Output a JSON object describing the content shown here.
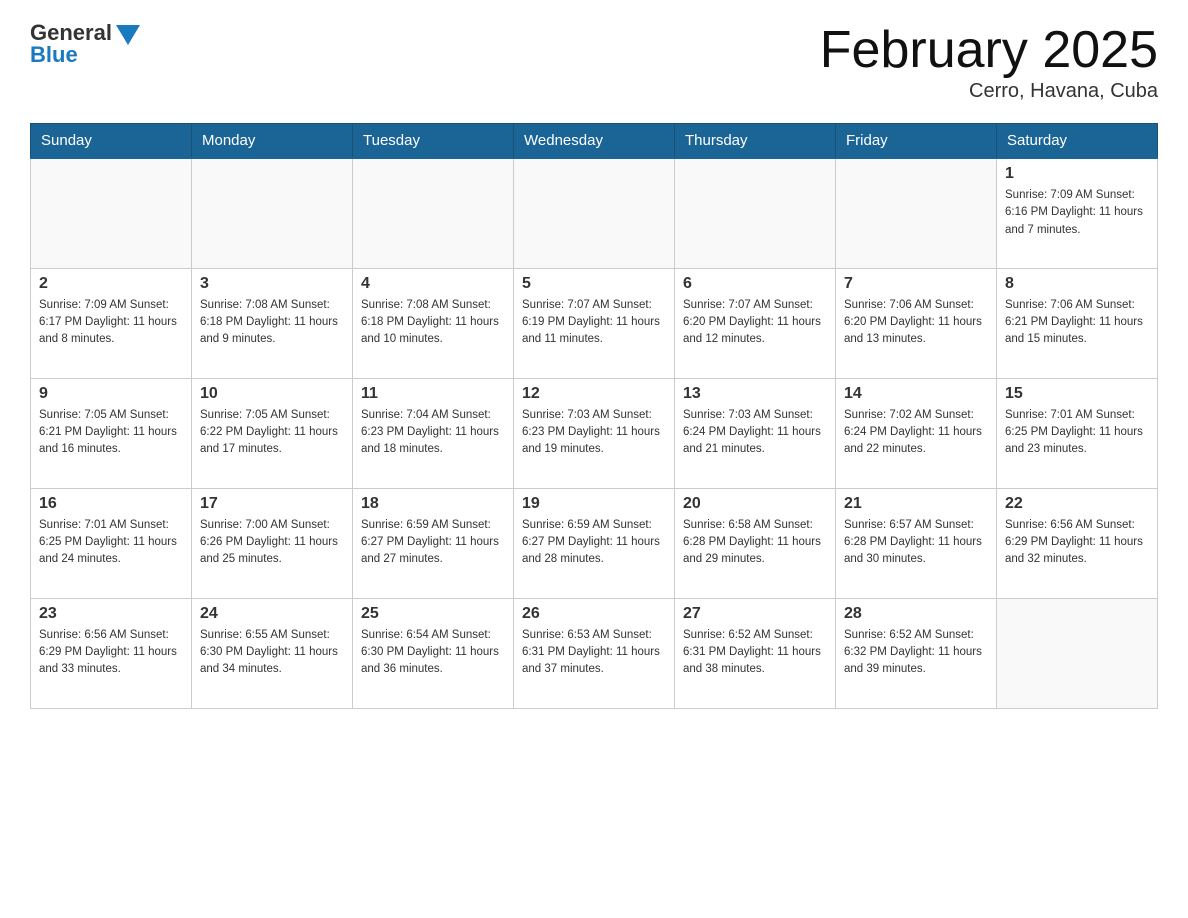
{
  "header": {
    "logo_general": "General",
    "logo_blue": "Blue",
    "month_title": "February 2025",
    "location": "Cerro, Havana, Cuba"
  },
  "weekdays": [
    "Sunday",
    "Monday",
    "Tuesday",
    "Wednesday",
    "Thursday",
    "Friday",
    "Saturday"
  ],
  "weeks": [
    [
      {
        "day": "",
        "info": ""
      },
      {
        "day": "",
        "info": ""
      },
      {
        "day": "",
        "info": ""
      },
      {
        "day": "",
        "info": ""
      },
      {
        "day": "",
        "info": ""
      },
      {
        "day": "",
        "info": ""
      },
      {
        "day": "1",
        "info": "Sunrise: 7:09 AM\nSunset: 6:16 PM\nDaylight: 11 hours and 7 minutes."
      }
    ],
    [
      {
        "day": "2",
        "info": "Sunrise: 7:09 AM\nSunset: 6:17 PM\nDaylight: 11 hours and 8 minutes."
      },
      {
        "day": "3",
        "info": "Sunrise: 7:08 AM\nSunset: 6:18 PM\nDaylight: 11 hours and 9 minutes."
      },
      {
        "day": "4",
        "info": "Sunrise: 7:08 AM\nSunset: 6:18 PM\nDaylight: 11 hours and 10 minutes."
      },
      {
        "day": "5",
        "info": "Sunrise: 7:07 AM\nSunset: 6:19 PM\nDaylight: 11 hours and 11 minutes."
      },
      {
        "day": "6",
        "info": "Sunrise: 7:07 AM\nSunset: 6:20 PM\nDaylight: 11 hours and 12 minutes."
      },
      {
        "day": "7",
        "info": "Sunrise: 7:06 AM\nSunset: 6:20 PM\nDaylight: 11 hours and 13 minutes."
      },
      {
        "day": "8",
        "info": "Sunrise: 7:06 AM\nSunset: 6:21 PM\nDaylight: 11 hours and 15 minutes."
      }
    ],
    [
      {
        "day": "9",
        "info": "Sunrise: 7:05 AM\nSunset: 6:21 PM\nDaylight: 11 hours and 16 minutes."
      },
      {
        "day": "10",
        "info": "Sunrise: 7:05 AM\nSunset: 6:22 PM\nDaylight: 11 hours and 17 minutes."
      },
      {
        "day": "11",
        "info": "Sunrise: 7:04 AM\nSunset: 6:23 PM\nDaylight: 11 hours and 18 minutes."
      },
      {
        "day": "12",
        "info": "Sunrise: 7:03 AM\nSunset: 6:23 PM\nDaylight: 11 hours and 19 minutes."
      },
      {
        "day": "13",
        "info": "Sunrise: 7:03 AM\nSunset: 6:24 PM\nDaylight: 11 hours and 21 minutes."
      },
      {
        "day": "14",
        "info": "Sunrise: 7:02 AM\nSunset: 6:24 PM\nDaylight: 11 hours and 22 minutes."
      },
      {
        "day": "15",
        "info": "Sunrise: 7:01 AM\nSunset: 6:25 PM\nDaylight: 11 hours and 23 minutes."
      }
    ],
    [
      {
        "day": "16",
        "info": "Sunrise: 7:01 AM\nSunset: 6:25 PM\nDaylight: 11 hours and 24 minutes."
      },
      {
        "day": "17",
        "info": "Sunrise: 7:00 AM\nSunset: 6:26 PM\nDaylight: 11 hours and 25 minutes."
      },
      {
        "day": "18",
        "info": "Sunrise: 6:59 AM\nSunset: 6:27 PM\nDaylight: 11 hours and 27 minutes."
      },
      {
        "day": "19",
        "info": "Sunrise: 6:59 AM\nSunset: 6:27 PM\nDaylight: 11 hours and 28 minutes."
      },
      {
        "day": "20",
        "info": "Sunrise: 6:58 AM\nSunset: 6:28 PM\nDaylight: 11 hours and 29 minutes."
      },
      {
        "day": "21",
        "info": "Sunrise: 6:57 AM\nSunset: 6:28 PM\nDaylight: 11 hours and 30 minutes."
      },
      {
        "day": "22",
        "info": "Sunrise: 6:56 AM\nSunset: 6:29 PM\nDaylight: 11 hours and 32 minutes."
      }
    ],
    [
      {
        "day": "23",
        "info": "Sunrise: 6:56 AM\nSunset: 6:29 PM\nDaylight: 11 hours and 33 minutes."
      },
      {
        "day": "24",
        "info": "Sunrise: 6:55 AM\nSunset: 6:30 PM\nDaylight: 11 hours and 34 minutes."
      },
      {
        "day": "25",
        "info": "Sunrise: 6:54 AM\nSunset: 6:30 PM\nDaylight: 11 hours and 36 minutes."
      },
      {
        "day": "26",
        "info": "Sunrise: 6:53 AM\nSunset: 6:31 PM\nDaylight: 11 hours and 37 minutes."
      },
      {
        "day": "27",
        "info": "Sunrise: 6:52 AM\nSunset: 6:31 PM\nDaylight: 11 hours and 38 minutes."
      },
      {
        "day": "28",
        "info": "Sunrise: 6:52 AM\nSunset: 6:32 PM\nDaylight: 11 hours and 39 minutes."
      },
      {
        "day": "",
        "info": ""
      }
    ]
  ]
}
